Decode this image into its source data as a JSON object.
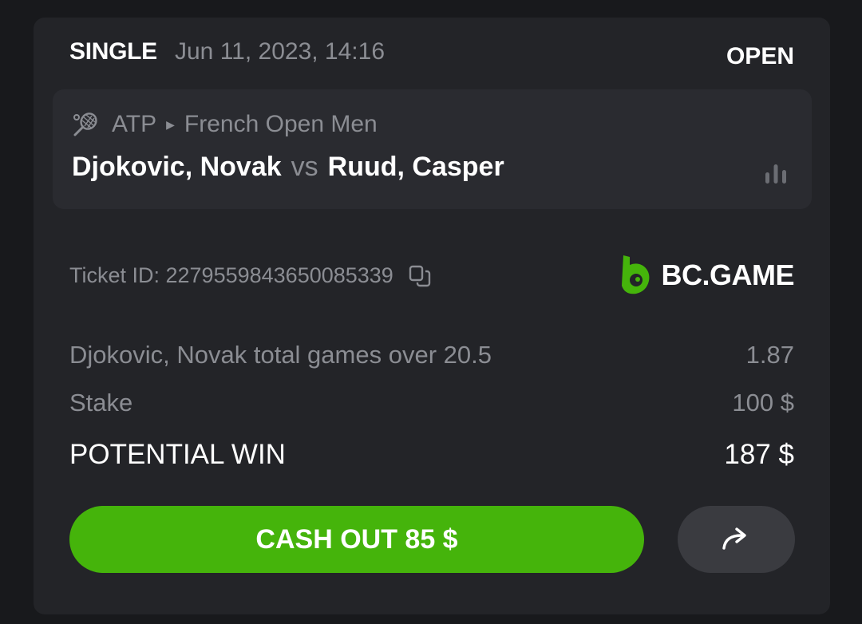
{
  "bet": {
    "type": "SINGLE",
    "date": "Jun 11, 2023, 14:16",
    "status": "OPEN"
  },
  "event": {
    "sport_icon": "tennis-racket-icon",
    "league": "ATP",
    "tournament": "French Open Men",
    "team1": "Djokovic, Novak",
    "vs": "vs",
    "team2": "Ruud, Casper",
    "stats_icon": "bar-chart-icon"
  },
  "ticket": {
    "label": "Ticket ID: 2279559843650085339",
    "copy_icon": "copy-icon"
  },
  "brand": {
    "name": "BC.GAME",
    "color": "#45b40b"
  },
  "selection": {
    "market": "Djokovic, Novak total games over 20.5",
    "odds": "1.87"
  },
  "stake": {
    "label": "Stake",
    "value": "100 $"
  },
  "potential_win": {
    "label": "POTENTIAL WIN",
    "value": "187 $"
  },
  "actions": {
    "cash_out_label": "CASH OUT 85 $",
    "share_icon": "share-arrow-icon"
  },
  "colors": {
    "background": "#18191c",
    "card": "#232428",
    "muted_text": "#8b8d93",
    "accent_green": "#45b40b"
  }
}
